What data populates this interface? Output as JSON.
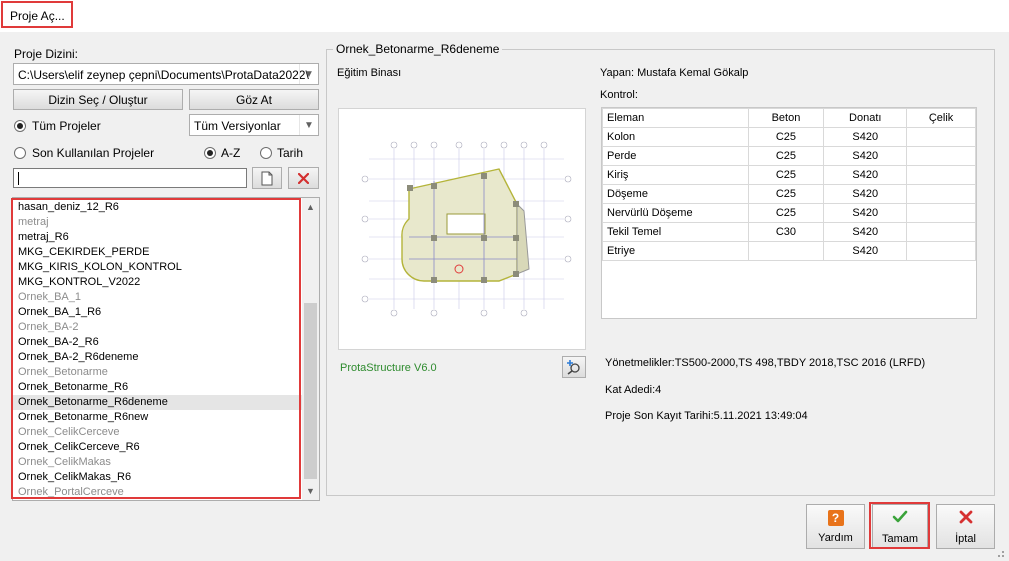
{
  "window": {
    "title": "Proje Aç..."
  },
  "left": {
    "dir_label": "Proje Dizini:",
    "dir_value": "C:\\Users\\elif zeynep çepni\\Documents\\ProtaData2022\\",
    "btn_select": "Dizin Seç / Oluştur",
    "btn_browse": "Göz At",
    "radio_all": "Tüm Projeler",
    "version_combo": "Tüm Versiyonlar",
    "radio_recent": "Son Kullanılan Projeler",
    "radio_az": "A-Z",
    "radio_date": "Tarih",
    "search_value": "",
    "projects": [
      {
        "name": "hasan_deniz_12_R6",
        "style": "normal"
      },
      {
        "name": "metraj",
        "style": "grey"
      },
      {
        "name": "metraj_R6",
        "style": "normal"
      },
      {
        "name": "MKG_CEKIRDEK_PERDE",
        "style": "normal"
      },
      {
        "name": "MKG_KIRIS_KOLON_KONTROL",
        "style": "normal"
      },
      {
        "name": "MKG_KONTROL_V2022",
        "style": "normal"
      },
      {
        "name": "Ornek_BA_1",
        "style": "grey"
      },
      {
        "name": "Ornek_BA_1_R6",
        "style": "normal"
      },
      {
        "name": "Ornek_BA-2",
        "style": "grey"
      },
      {
        "name": "Ornek_BA-2_R6",
        "style": "normal"
      },
      {
        "name": "Ornek_BA-2_R6deneme",
        "style": "normal"
      },
      {
        "name": "Ornek_Betonarme",
        "style": "grey"
      },
      {
        "name": "Ornek_Betonarme_R6",
        "style": "normal"
      },
      {
        "name": "Ornek_Betonarme_R6deneme",
        "style": "selected"
      },
      {
        "name": "Ornek_Betonarme_R6new",
        "style": "normal"
      },
      {
        "name": "Ornek_CelikCerceve",
        "style": "grey"
      },
      {
        "name": "Ornek_CelikCerceve_R6",
        "style": "normal"
      },
      {
        "name": "Ornek_CelikMakas",
        "style": "grey"
      },
      {
        "name": "Ornek_CelikMakas_R6",
        "style": "normal"
      },
      {
        "name": "Ornek_PortalCerceve",
        "style": "grey"
      }
    ]
  },
  "detail": {
    "group_title": "Ornek_Betonarme_R6deneme",
    "building": "Eğitim Binası",
    "author": "Yapan: Mustafa Kemal Gökalp",
    "control_label": "Kontrol:",
    "table_headers": [
      "Eleman",
      "Beton",
      "Donatı",
      "Çelik"
    ],
    "table_rows": [
      [
        "Kolon",
        "C25",
        "S420",
        ""
      ],
      [
        "Perde",
        "C25",
        "S420",
        ""
      ],
      [
        "Kiriş",
        "C25",
        "S420",
        ""
      ],
      [
        "Döşeme",
        "C25",
        "S420",
        ""
      ],
      [
        "Nervürlü Döşeme",
        "C25",
        "S420",
        ""
      ],
      [
        "Tekil Temel",
        "C30",
        "S420",
        ""
      ],
      [
        "Etriye",
        "",
        "S420",
        ""
      ]
    ],
    "version": "ProtaStructure V6.0",
    "codes": "Yönetmelikler:TS500-2000,TS 498,TBDY 2018,TSC 2016 (LRFD)",
    "floors": "Kat Adedi:4",
    "last_saved": "Proje Son Kayıt Tarihi:5.11.2021 13:49:04"
  },
  "buttons": {
    "help": "Yardım",
    "ok": "Tamam",
    "cancel": "İptal"
  },
  "colors": {
    "version_green": "#2e8b2e",
    "highlight_red": "#e03a3a",
    "help_orange": "#e8731a",
    "ok_green": "#3aa33a",
    "cancel_red": "#d63030"
  }
}
